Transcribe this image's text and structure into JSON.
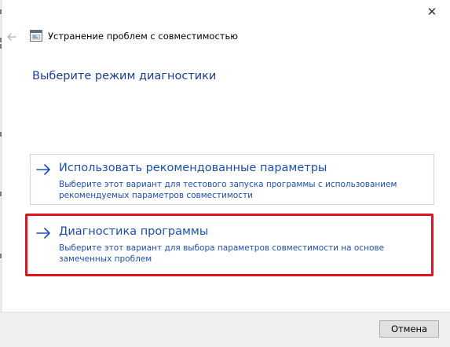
{
  "window": {
    "title": "Устранение проблем с совместимостью",
    "close_glyph": "✕",
    "back_icon": "back-arrow-icon",
    "app_icon": "compatibility-troubleshooter-icon"
  },
  "page": {
    "heading": "Выберите режим диагностики"
  },
  "options": [
    {
      "icon": "arrow-right-icon",
      "title": "Использовать рекомендованные параметры",
      "description": "Выберите этот вариант для тестового запуска программы с использованием рекомендуемых параметров совместимости"
    },
    {
      "icon": "arrow-right-icon",
      "title": "Диагностика программы",
      "description": "Выберите этот вариант для выбора параметров совместимости на основе замеченных проблем"
    }
  ],
  "footer": {
    "cancel_label": "Отмена"
  },
  "colors": {
    "accent_text": "#1b4fb8",
    "heading_text": "#1a3e9a",
    "highlight_border": "#e0141e",
    "option_border": "#c6d8ee"
  }
}
